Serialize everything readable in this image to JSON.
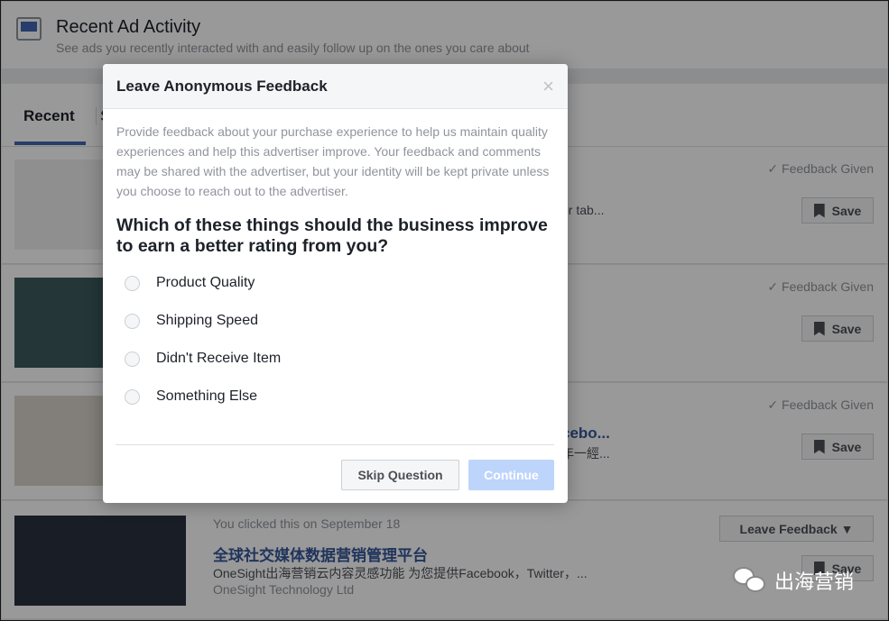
{
  "header": {
    "title": "Recent Ad Activity",
    "subtitle": "See ads you recently interacted with and easily follow up on the ones you care about",
    "icon": "monitor-icon"
  },
  "tabs": [
    {
      "label": "Recent"
    },
    {
      "label": "S"
    }
  ],
  "rows": [
    {
      "status": "Feedback Given",
      "save": "Save",
      "snippet": "or tab..."
    },
    {
      "status": "Feedback Given",
      "save": "Save"
    },
    {
      "status": "Feedback Given",
      "save": "Save",
      "title_snippet": "cebo...",
      "desc_snippet": "年一經..."
    },
    {
      "clicked": "You clicked this on September 18",
      "title": "全球社交媒体数据营销管理平台",
      "desc": "OneSight出海营销云内容灵感功能 为您提供Facebook，Twitter，...",
      "advertiser": "OneSight Technology Ltd",
      "feedback_button": "Leave Feedback ▼",
      "save": "Save"
    }
  ],
  "modal": {
    "title": "Leave Anonymous Feedback",
    "close": "×",
    "description": "Provide feedback about your purchase experience to help us maintain quality experiences and help this advertiser improve. Your feedback and comments may be shared with the advertiser, but your identity will be kept private unless you choose to reach out to the advertiser.",
    "question": "Which of these things should the business improve to earn a better rating from you?",
    "options": [
      "Product Quality",
      "Shipping Speed",
      "Didn't Receive Item",
      "Something Else"
    ],
    "skip": "Skip Question",
    "continue": "Continue"
  },
  "watermark": "出海营销",
  "colors": {
    "accent": "#4267b2",
    "continue_disabled": "#bdd4fb"
  }
}
